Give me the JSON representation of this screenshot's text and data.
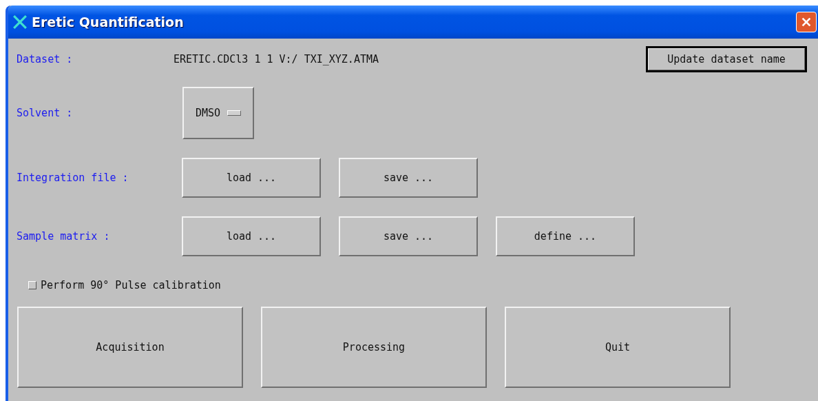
{
  "window": {
    "title": "Eretic Quantification"
  },
  "dataset": {
    "label": "Dataset :",
    "value": "ERETIC.CDCl3 1 1 V:/ TXI_XYZ.ATMA",
    "button": "Update dataset name"
  },
  "solvent": {
    "label": "Solvent :",
    "value": "DMSO"
  },
  "file_rows": [
    {
      "label": "Integration file :",
      "buttons": [
        "load ...",
        "save ..."
      ]
    },
    {
      "label": "Sample matrix :",
      "buttons": [
        "load ...",
        "save ...",
        "define ..."
      ]
    }
  ],
  "calibration": {
    "label": "Perform 90° Pulse calibration",
    "checked": false
  },
  "actions": [
    "Acquisition",
    "Processing",
    "Quit"
  ]
}
